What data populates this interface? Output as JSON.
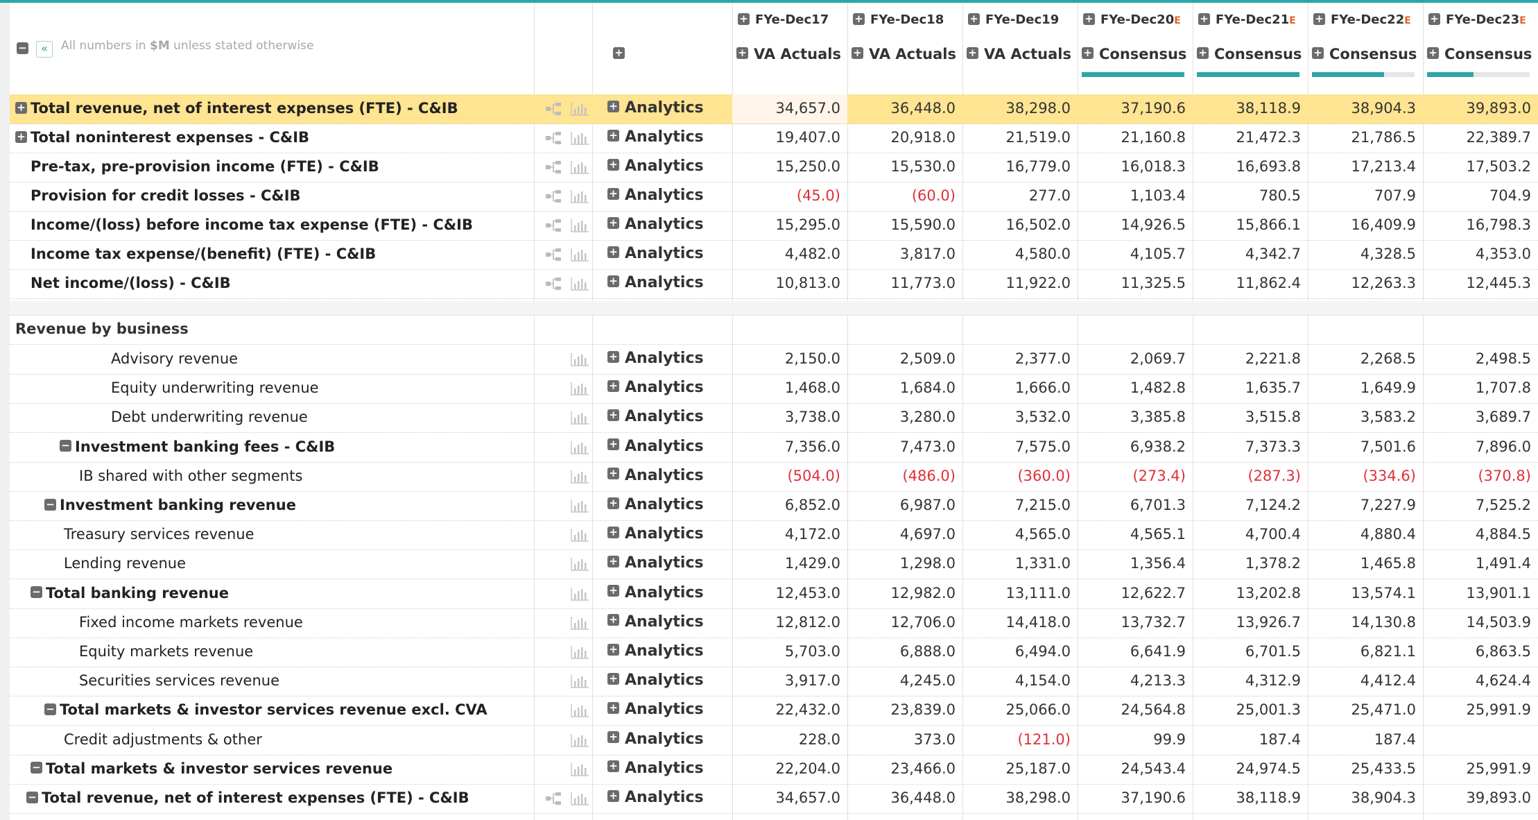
{
  "header": {
    "units_note_prefix": "All numbers in ",
    "units_note_unit": "$M",
    "units_note_suffix": " unless stated otherwise",
    "columns": [
      {
        "period": "FYe-Dec17",
        "estimate": "",
        "source": "VA Actuals",
        "consensus_bar": null
      },
      {
        "period": "FYe-Dec18",
        "estimate": "",
        "source": "VA Actuals",
        "consensus_bar": null
      },
      {
        "period": "FYe-Dec19",
        "estimate": "",
        "source": "VA Actuals",
        "consensus_bar": null
      },
      {
        "period": "FYe-Dec20",
        "estimate": "E",
        "source": "Consensus",
        "consensus_bar": 1.0
      },
      {
        "period": "FYe-Dec21",
        "estimate": "E",
        "source": "Consensus",
        "consensus_bar": 1.0
      },
      {
        "period": "FYe-Dec22",
        "estimate": "E",
        "source": "Consensus",
        "consensus_bar": 0.7
      },
      {
        "period": "FYe-Dec23",
        "estimate": "E",
        "source": "Consensus",
        "consensus_bar": 0.45
      }
    ]
  },
  "analytics_label": "Analytics",
  "section_title": "Revenue by business",
  "colors": {
    "accent": "#2aa8a8",
    "highlight": "#ffe491",
    "negative": "#e0303a",
    "estimate": "#e0622a"
  },
  "top_rows": [
    {
      "label": "Total revenue, net of interest expenses (FTE) - C&IB",
      "toggle": "plus",
      "highlight": true,
      "values": [
        "34,657.0",
        "36,448.0",
        "38,298.0",
        "37,190.6",
        "38,118.9",
        "38,904.3",
        "39,893.0"
      ]
    },
    {
      "label": "Total noninterest expenses - C&IB",
      "toggle": "plus",
      "highlight": false,
      "values": [
        "19,407.0",
        "20,918.0",
        "21,519.0",
        "21,160.8",
        "21,472.3",
        "21,786.5",
        "22,389.7"
      ]
    },
    {
      "label": "Pre-tax, pre-provision income (FTE) - C&IB",
      "toggle": "",
      "highlight": false,
      "values": [
        "15,250.0",
        "15,530.0",
        "16,779.0",
        "16,018.3",
        "16,693.8",
        "17,213.4",
        "17,503.2"
      ]
    },
    {
      "label": "Provision for credit losses - C&IB",
      "toggle": "",
      "highlight": false,
      "values": [
        "(45.0)",
        "(60.0)",
        "277.0",
        "1,103.4",
        "780.5",
        "707.9",
        "704.9"
      ]
    },
    {
      "label": "Income/(loss) before income tax expense (FTE) - C&IB",
      "toggle": "",
      "highlight": false,
      "values": [
        "15,295.0",
        "15,590.0",
        "16,502.0",
        "14,926.5",
        "15,866.1",
        "16,409.9",
        "16,798.3"
      ]
    },
    {
      "label": "Income tax expense/(benefit) (FTE) - C&IB",
      "toggle": "",
      "highlight": false,
      "values": [
        "4,482.0",
        "3,817.0",
        "4,580.0",
        "4,105.7",
        "4,342.7",
        "4,328.5",
        "4,353.0"
      ]
    },
    {
      "label": "Net income/(loss) - C&IB",
      "toggle": "",
      "highlight": false,
      "values": [
        "10,813.0",
        "11,773.0",
        "11,922.0",
        "11,325.5",
        "11,862.4",
        "12,263.3",
        "12,445.3"
      ]
    }
  ],
  "business_rows": [
    {
      "label": "Advisory revenue",
      "bold": false,
      "toggle": "",
      "indent": 4,
      "tree": false,
      "values": [
        "2,150.0",
        "2,509.0",
        "2,377.0",
        "2,069.7",
        "2,221.8",
        "2,268.5",
        "2,498.5"
      ]
    },
    {
      "label": "Equity underwriting revenue",
      "bold": false,
      "toggle": "",
      "indent": 4,
      "tree": false,
      "values": [
        "1,468.0",
        "1,684.0",
        "1,666.0",
        "1,482.8",
        "1,635.7",
        "1,649.9",
        "1,707.8"
      ]
    },
    {
      "label": "Debt underwriting revenue",
      "bold": false,
      "toggle": "",
      "indent": 4,
      "tree": false,
      "values": [
        "3,738.0",
        "3,280.0",
        "3,532.0",
        "3,385.8",
        "3,515.8",
        "3,583.2",
        "3,689.7"
      ]
    },
    {
      "label": "Investment banking fees - C&IB",
      "bold": true,
      "toggle": "minus",
      "indent": 3,
      "tree": false,
      "values": [
        "7,356.0",
        "7,473.0",
        "7,575.0",
        "6,938.2",
        "7,373.3",
        "7,501.6",
        "7,896.0"
      ]
    },
    {
      "label": "IB shared with other segments",
      "bold": false,
      "toggle": "",
      "indent": 3,
      "tree": false,
      "values": [
        "(504.0)",
        "(486.0)",
        "(360.0)",
        "(273.4)",
        "(287.3)",
        "(334.6)",
        "(370.8)"
      ]
    },
    {
      "label": "Investment banking revenue",
      "bold": true,
      "toggle": "minus",
      "indent": 2,
      "tree": false,
      "values": [
        "6,852.0",
        "6,987.0",
        "7,215.0",
        "6,701.3",
        "7,124.2",
        "7,227.9",
        "7,525.2"
      ]
    },
    {
      "label": "Treasury services revenue",
      "bold": false,
      "toggle": "",
      "indent": 2,
      "tree": false,
      "values": [
        "4,172.0",
        "4,697.0",
        "4,565.0",
        "4,565.1",
        "4,700.4",
        "4,880.4",
        "4,884.5"
      ]
    },
    {
      "label": "Lending revenue",
      "bold": false,
      "toggle": "",
      "indent": 2,
      "tree": false,
      "values": [
        "1,429.0",
        "1,298.0",
        "1,331.0",
        "1,356.4",
        "1,378.2",
        "1,465.8",
        "1,491.4"
      ]
    },
    {
      "label": "Total banking revenue",
      "bold": true,
      "toggle": "minus",
      "indent": 1,
      "tree": false,
      "values": [
        "12,453.0",
        "12,982.0",
        "13,111.0",
        "12,622.7",
        "13,202.8",
        "13,574.1",
        "13,901.1"
      ]
    },
    {
      "label": "Fixed income markets revenue",
      "bold": false,
      "toggle": "",
      "indent": 3,
      "tree": false,
      "values": [
        "12,812.0",
        "12,706.0",
        "14,418.0",
        "13,732.7",
        "13,926.7",
        "14,130.8",
        "14,503.9"
      ]
    },
    {
      "label": "Equity markets revenue",
      "bold": false,
      "toggle": "",
      "indent": 3,
      "tree": false,
      "values": [
        "5,703.0",
        "6,888.0",
        "6,494.0",
        "6,641.9",
        "6,701.5",
        "6,821.1",
        "6,863.5"
      ]
    },
    {
      "label": "Securities services revenue",
      "bold": false,
      "toggle": "",
      "indent": 3,
      "tree": false,
      "values": [
        "3,917.0",
        "4,245.0",
        "4,154.0",
        "4,213.3",
        "4,312.9",
        "4,412.4",
        "4,624.4"
      ]
    },
    {
      "label": "Total markets & investor services revenue excl. CVA",
      "bold": true,
      "toggle": "minus",
      "indent": 2,
      "tree": false,
      "values": [
        "22,432.0",
        "23,839.0",
        "25,066.0",
        "24,564.8",
        "25,001.3",
        "25,471.0",
        "25,991.9"
      ]
    },
    {
      "label": "Credit adjustments & other",
      "bold": false,
      "toggle": "",
      "indent": 2,
      "tree": false,
      "values": [
        "228.0",
        "373.0",
        "(121.0)",
        "99.9",
        "187.4",
        "187.4",
        ""
      ]
    },
    {
      "label": "Total markets & investor services revenue",
      "bold": true,
      "toggle": "minus",
      "indent": 1,
      "tree": false,
      "values": [
        "22,204.0",
        "23,466.0",
        "25,187.0",
        "24,543.4",
        "24,974.5",
        "25,433.5",
        "25,991.9"
      ]
    },
    {
      "label": "Total revenue, net of interest expenses (FTE) - C&IB",
      "bold": true,
      "toggle": "minus",
      "indent": 0,
      "tree": true,
      "values": [
        "34,657.0",
        "36,448.0",
        "38,298.0",
        "37,190.6",
        "38,118.9",
        "38,904.3",
        "39,893.0"
      ]
    }
  ]
}
